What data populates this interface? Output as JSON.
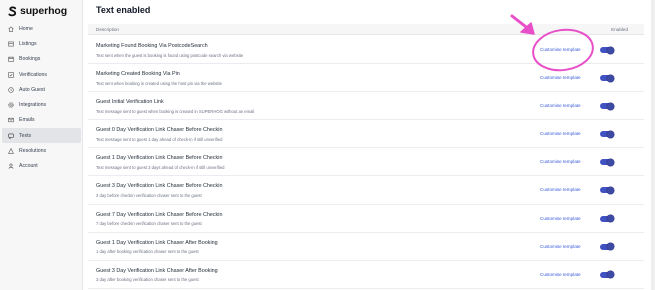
{
  "brand": {
    "name": "superhog"
  },
  "sidebar": {
    "items": [
      {
        "label": "Home",
        "icon": "home-icon"
      },
      {
        "label": "Listings",
        "icon": "listings-icon"
      },
      {
        "label": "Bookings",
        "icon": "bookings-icon"
      },
      {
        "label": "Verifications",
        "icon": "verifications-icon"
      },
      {
        "label": "Auto Guest",
        "icon": "auto-guest-icon"
      },
      {
        "label": "Integrations",
        "icon": "integrations-icon"
      },
      {
        "label": "Emails",
        "icon": "emails-icon"
      },
      {
        "label": "Texts",
        "icon": "texts-icon",
        "active": true
      },
      {
        "label": "Resolutions",
        "icon": "resolutions-icon"
      },
      {
        "label": "Account",
        "icon": "account-icon"
      }
    ]
  },
  "main": {
    "title": "Text enabled",
    "columns": {
      "description": "Description",
      "enabled": "Enabled"
    },
    "rows": [
      {
        "title": "Marketing Found Booking Via PostcodeSearch",
        "description": "Text sent when the guest is booking is found using postcode search via website",
        "link": "Customise template",
        "enabled": true
      },
      {
        "title": "Marketing Created Booking Via Pin",
        "description": "Text sent when booking is created using the host pin via the website",
        "link": "Customise template",
        "enabled": true
      },
      {
        "title": "Guest Initial Verification Link",
        "description": "Text message sent to guest when booking is created in SUPERHOG without an email",
        "link": "Customise template",
        "enabled": true
      },
      {
        "title": "Guest 0 Day Verification Link Chaser Before Checkin",
        "description": "Text message sent to guest 1 day ahead of check-in if still unverified",
        "link": "Customise template",
        "enabled": true
      },
      {
        "title": "Guest 1 Day Verification Link Chaser Before Checkin",
        "description": "Text message sent to guest 3 days ahead of check-in if still unverified",
        "link": "Customise template",
        "enabled": true
      },
      {
        "title": "Guest 3 Day Verification Link Chaser Before Checkin",
        "description": "3 day before checkin verification chaser sent to the guest",
        "link": "Customise template",
        "enabled": true
      },
      {
        "title": "Guest 7 Day Verification Link Chaser Before Checkin",
        "description": "7 day before checkin verification chaser sent to the guest",
        "link": "Customise template",
        "enabled": true
      },
      {
        "title": "Guest 1 Day Verification Link Chaser After Booking",
        "description": "1 day after booking verification chaser sent to the guest",
        "link": "Customise template",
        "enabled": true
      },
      {
        "title": "Guest 3 Day Verification Link Chaser After Booking",
        "description": "3 day after booking verification chaser sent to the guest",
        "link": "Customise template",
        "enabled": true
      }
    ]
  },
  "colors": {
    "link": "#3b5bd9",
    "toggle_on": "#4051c2",
    "annotation": "#e84fc8"
  }
}
